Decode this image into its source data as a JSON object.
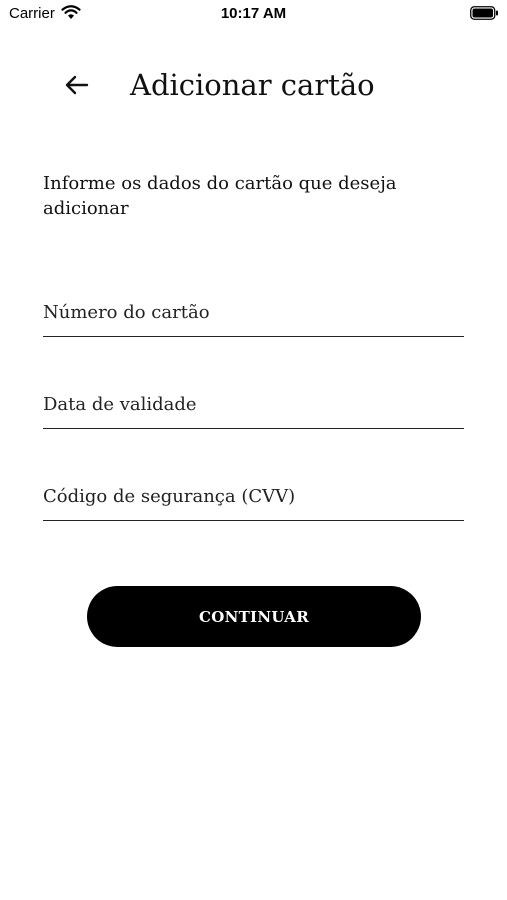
{
  "status_bar": {
    "carrier": "Carrier",
    "time": "10:17 AM",
    "icons": [
      "wifi-icon",
      "battery-icon"
    ]
  },
  "header": {
    "back_icon": "arrow-left-icon",
    "title": "Adicionar cartão"
  },
  "form": {
    "intro": "Informe os dados do cartão que deseja adicionar",
    "fields": [
      {
        "placeholder": "Número do cartão",
        "value": ""
      },
      {
        "placeholder": "Data de validade",
        "value": ""
      },
      {
        "placeholder": "Código de segurança (CVV)",
        "value": ""
      }
    ],
    "submit_label": "CONTINUAR"
  },
  "colors": {
    "background": "#ffffff",
    "text": "#111111",
    "button_background": "#000000",
    "button_text": "#ffffff"
  }
}
